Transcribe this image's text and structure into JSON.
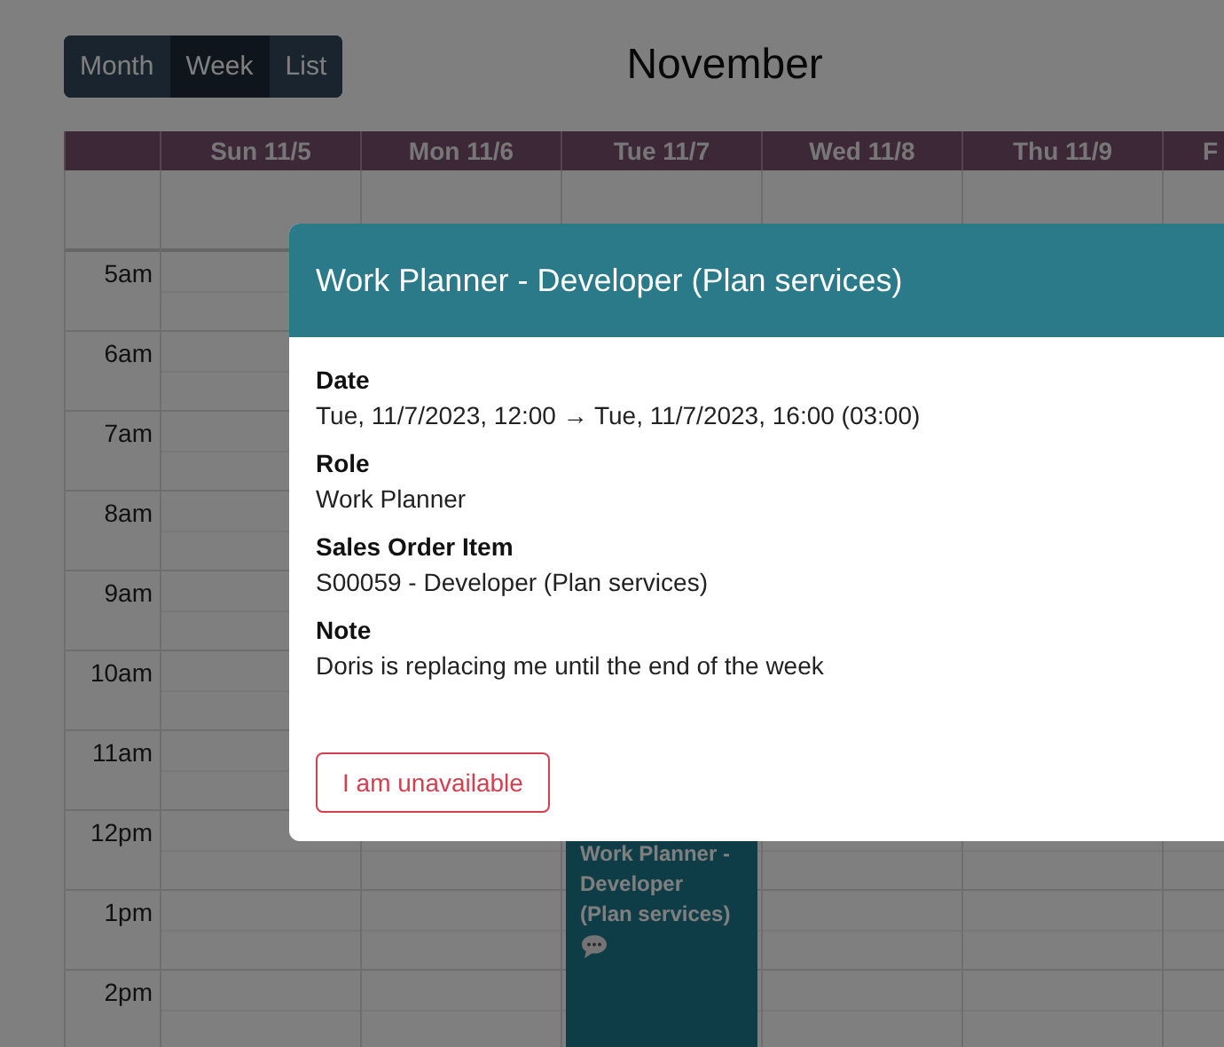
{
  "view_switcher": [
    {
      "label": "Month",
      "selected": false
    },
    {
      "label": "Week",
      "selected": true
    },
    {
      "label": "List",
      "selected": false
    }
  ],
  "title": "November",
  "calendar": {
    "columns": [
      {
        "label": "Sun 11/5"
      },
      {
        "label": "Mon 11/6"
      },
      {
        "label": "Tue 11/7",
        "events": [
          {
            "title": "Work Planner - Developer (Plan services)",
            "has_note": true
          }
        ]
      },
      {
        "label": "Wed 11/8"
      },
      {
        "label": "Thu 11/9"
      },
      {
        "label": "F"
      }
    ],
    "hours": [
      "5am",
      "6am",
      "7am",
      "8am",
      "9am",
      "10am",
      "11am",
      "12pm",
      "1pm",
      "2pm"
    ]
  },
  "popup": {
    "title": "Work Planner - Developer (Plan services)",
    "fields": [
      {
        "label": "Date",
        "value": "Tue, 11/7/2023, 12:00 → Tue, 11/7/2023, 16:00 (03:00)"
      },
      {
        "label": "Role",
        "value": "Work Planner"
      },
      {
        "label": "Sales Order Item",
        "value": "S00059 - Developer (Plan services)"
      },
      {
        "label": "Note",
        "value": "Doris is replacing me until the end of the week"
      }
    ],
    "button": "I am unavailable"
  }
}
